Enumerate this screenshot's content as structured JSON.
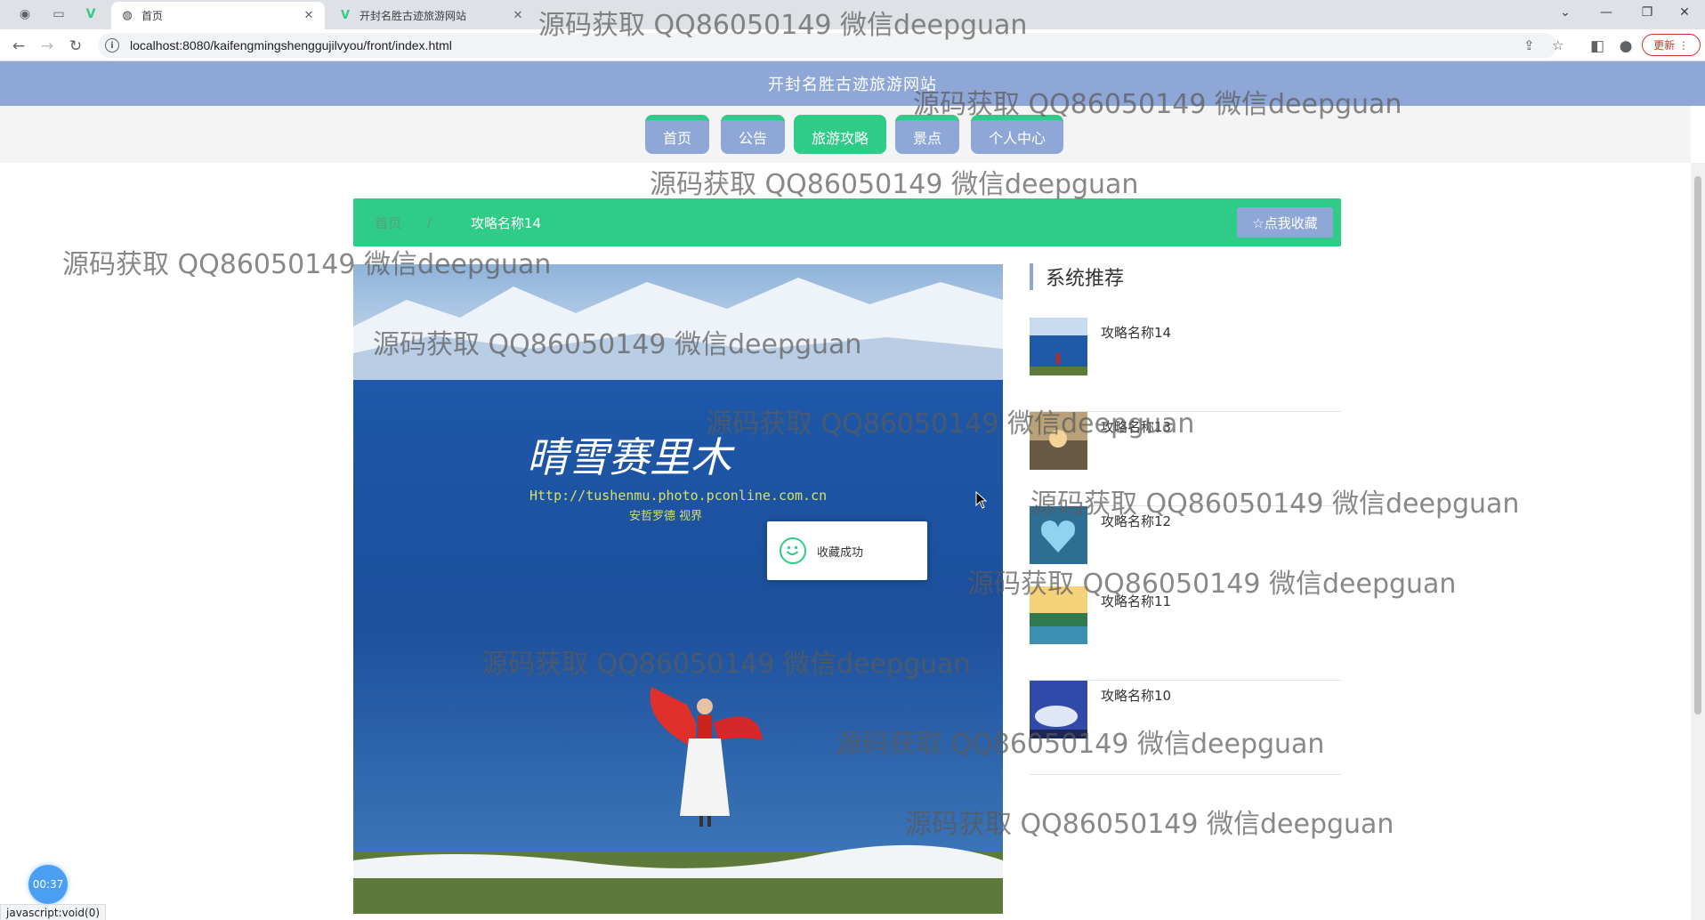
{
  "browser": {
    "tabs": [
      {
        "title": "首页",
        "active": true
      },
      {
        "title": "开封名胜古迹旅游网站",
        "active": false
      }
    ],
    "url": "localhost:8080/kaifengmingshenggujilvyou/front/index.html",
    "update_label": "更新",
    "status_url": "javascript:void(0)"
  },
  "site": {
    "title": "开封名胜古迹旅游网站",
    "nav": [
      "首页",
      "公告",
      "旅游攻略",
      "景点",
      "个人中心"
    ],
    "active_nav": "旅游攻略"
  },
  "main": {
    "breadcrumb": [
      "首页",
      "/",
      "攻略名称14"
    ],
    "favorite_label": "☆点我收藏",
    "hero": {
      "logo_text": "晴雪赛里木",
      "logo_url": "Http://tushenmu.photo.pconline.com.cn",
      "logo_sub": "安哲罗德  视界"
    }
  },
  "sidebar": {
    "title": "系统推荐",
    "items": [
      "攻略名称14",
      "攻略名称13",
      "攻略名称12",
      "攻略名称11",
      "攻略名称10"
    ]
  },
  "toast": {
    "text": "收藏成功"
  },
  "recorder": {
    "time": "00:37"
  },
  "watermark": "源码获取 QQ86050149 微信deepguan",
  "colors": {
    "header": "#8fa7d6",
    "accent": "#2ecc87",
    "timer": "#4a9ff5"
  }
}
